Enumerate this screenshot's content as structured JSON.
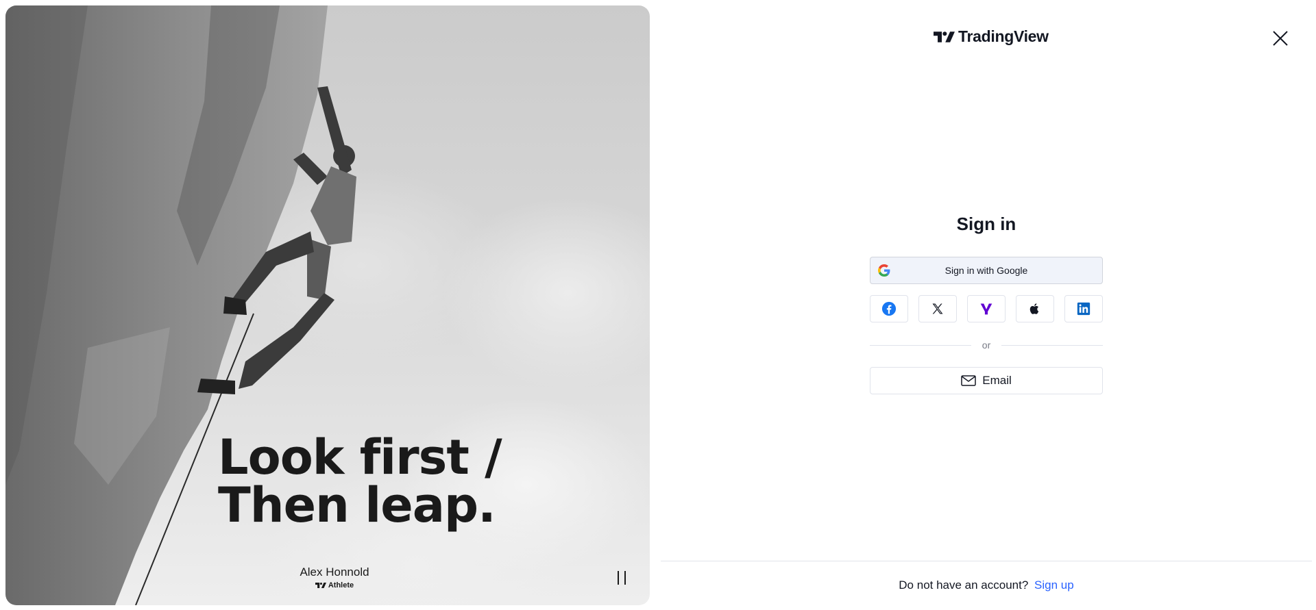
{
  "hero": {
    "slogan_line1": "Look first /",
    "slogan_line2": "Then leap.",
    "athlete_name": "Alex Honnold",
    "athlete_role": "Athlete"
  },
  "header": {
    "brand": "TradingView"
  },
  "signin": {
    "title": "Sign in",
    "google_label": "Sign in with Google",
    "social_providers": [
      "facebook",
      "x",
      "yahoo",
      "apple",
      "linkedin"
    ],
    "divider_text": "or",
    "email_label": "Email"
  },
  "footer": {
    "prompt": "Do not have an account?",
    "signup_link": "Sign up"
  },
  "colors": {
    "link": "#2962ff",
    "text": "#131722",
    "google_button_bg": "#f0f3fa",
    "facebook": "#1877f2",
    "yahoo": "#6001d2",
    "linkedin": "#0a66c2"
  }
}
